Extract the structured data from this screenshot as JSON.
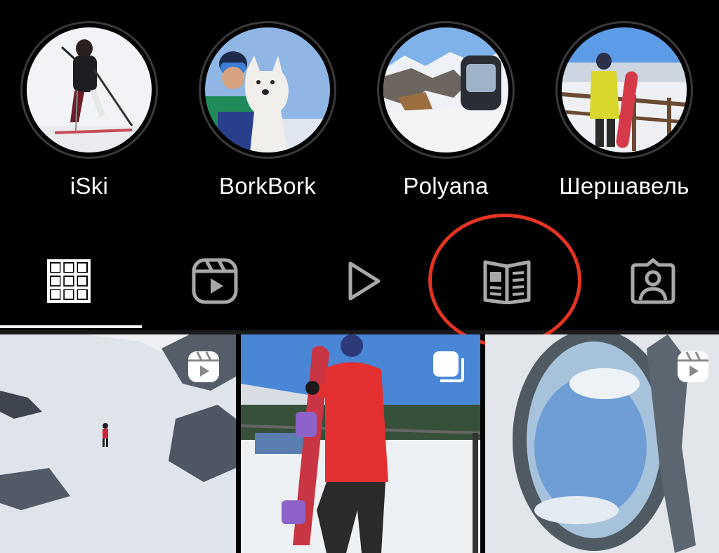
{
  "highlights": [
    {
      "name": "iSki",
      "icon": "skier-photo"
    },
    {
      "name": "BorkBork",
      "icon": "dog-photo"
    },
    {
      "name": "Polyana",
      "icon": "gondola-photo"
    },
    {
      "name": "Шершавель",
      "icon": "snowboarder-photo"
    }
  ],
  "tabs": [
    {
      "name": "posts",
      "icon": "grid-icon",
      "selected": true
    },
    {
      "name": "reels",
      "icon": "reels-icon"
    },
    {
      "name": "videos",
      "icon": "play-icon"
    },
    {
      "name": "guides",
      "icon": "guide-book-icon"
    },
    {
      "name": "tagged",
      "icon": "tagged-person-icon"
    }
  ],
  "grid": [
    {
      "type": "reel",
      "badge": "reels-badge-icon"
    },
    {
      "type": "carousel",
      "badge": "carousel-badge-icon"
    },
    {
      "type": "reel",
      "badge": "reels-badge-icon"
    }
  ],
  "colors": {
    "background": "#000000",
    "annotation": "#e63323",
    "icon_inactive": "#a8a8a8",
    "icon_active": "#ffffff"
  }
}
